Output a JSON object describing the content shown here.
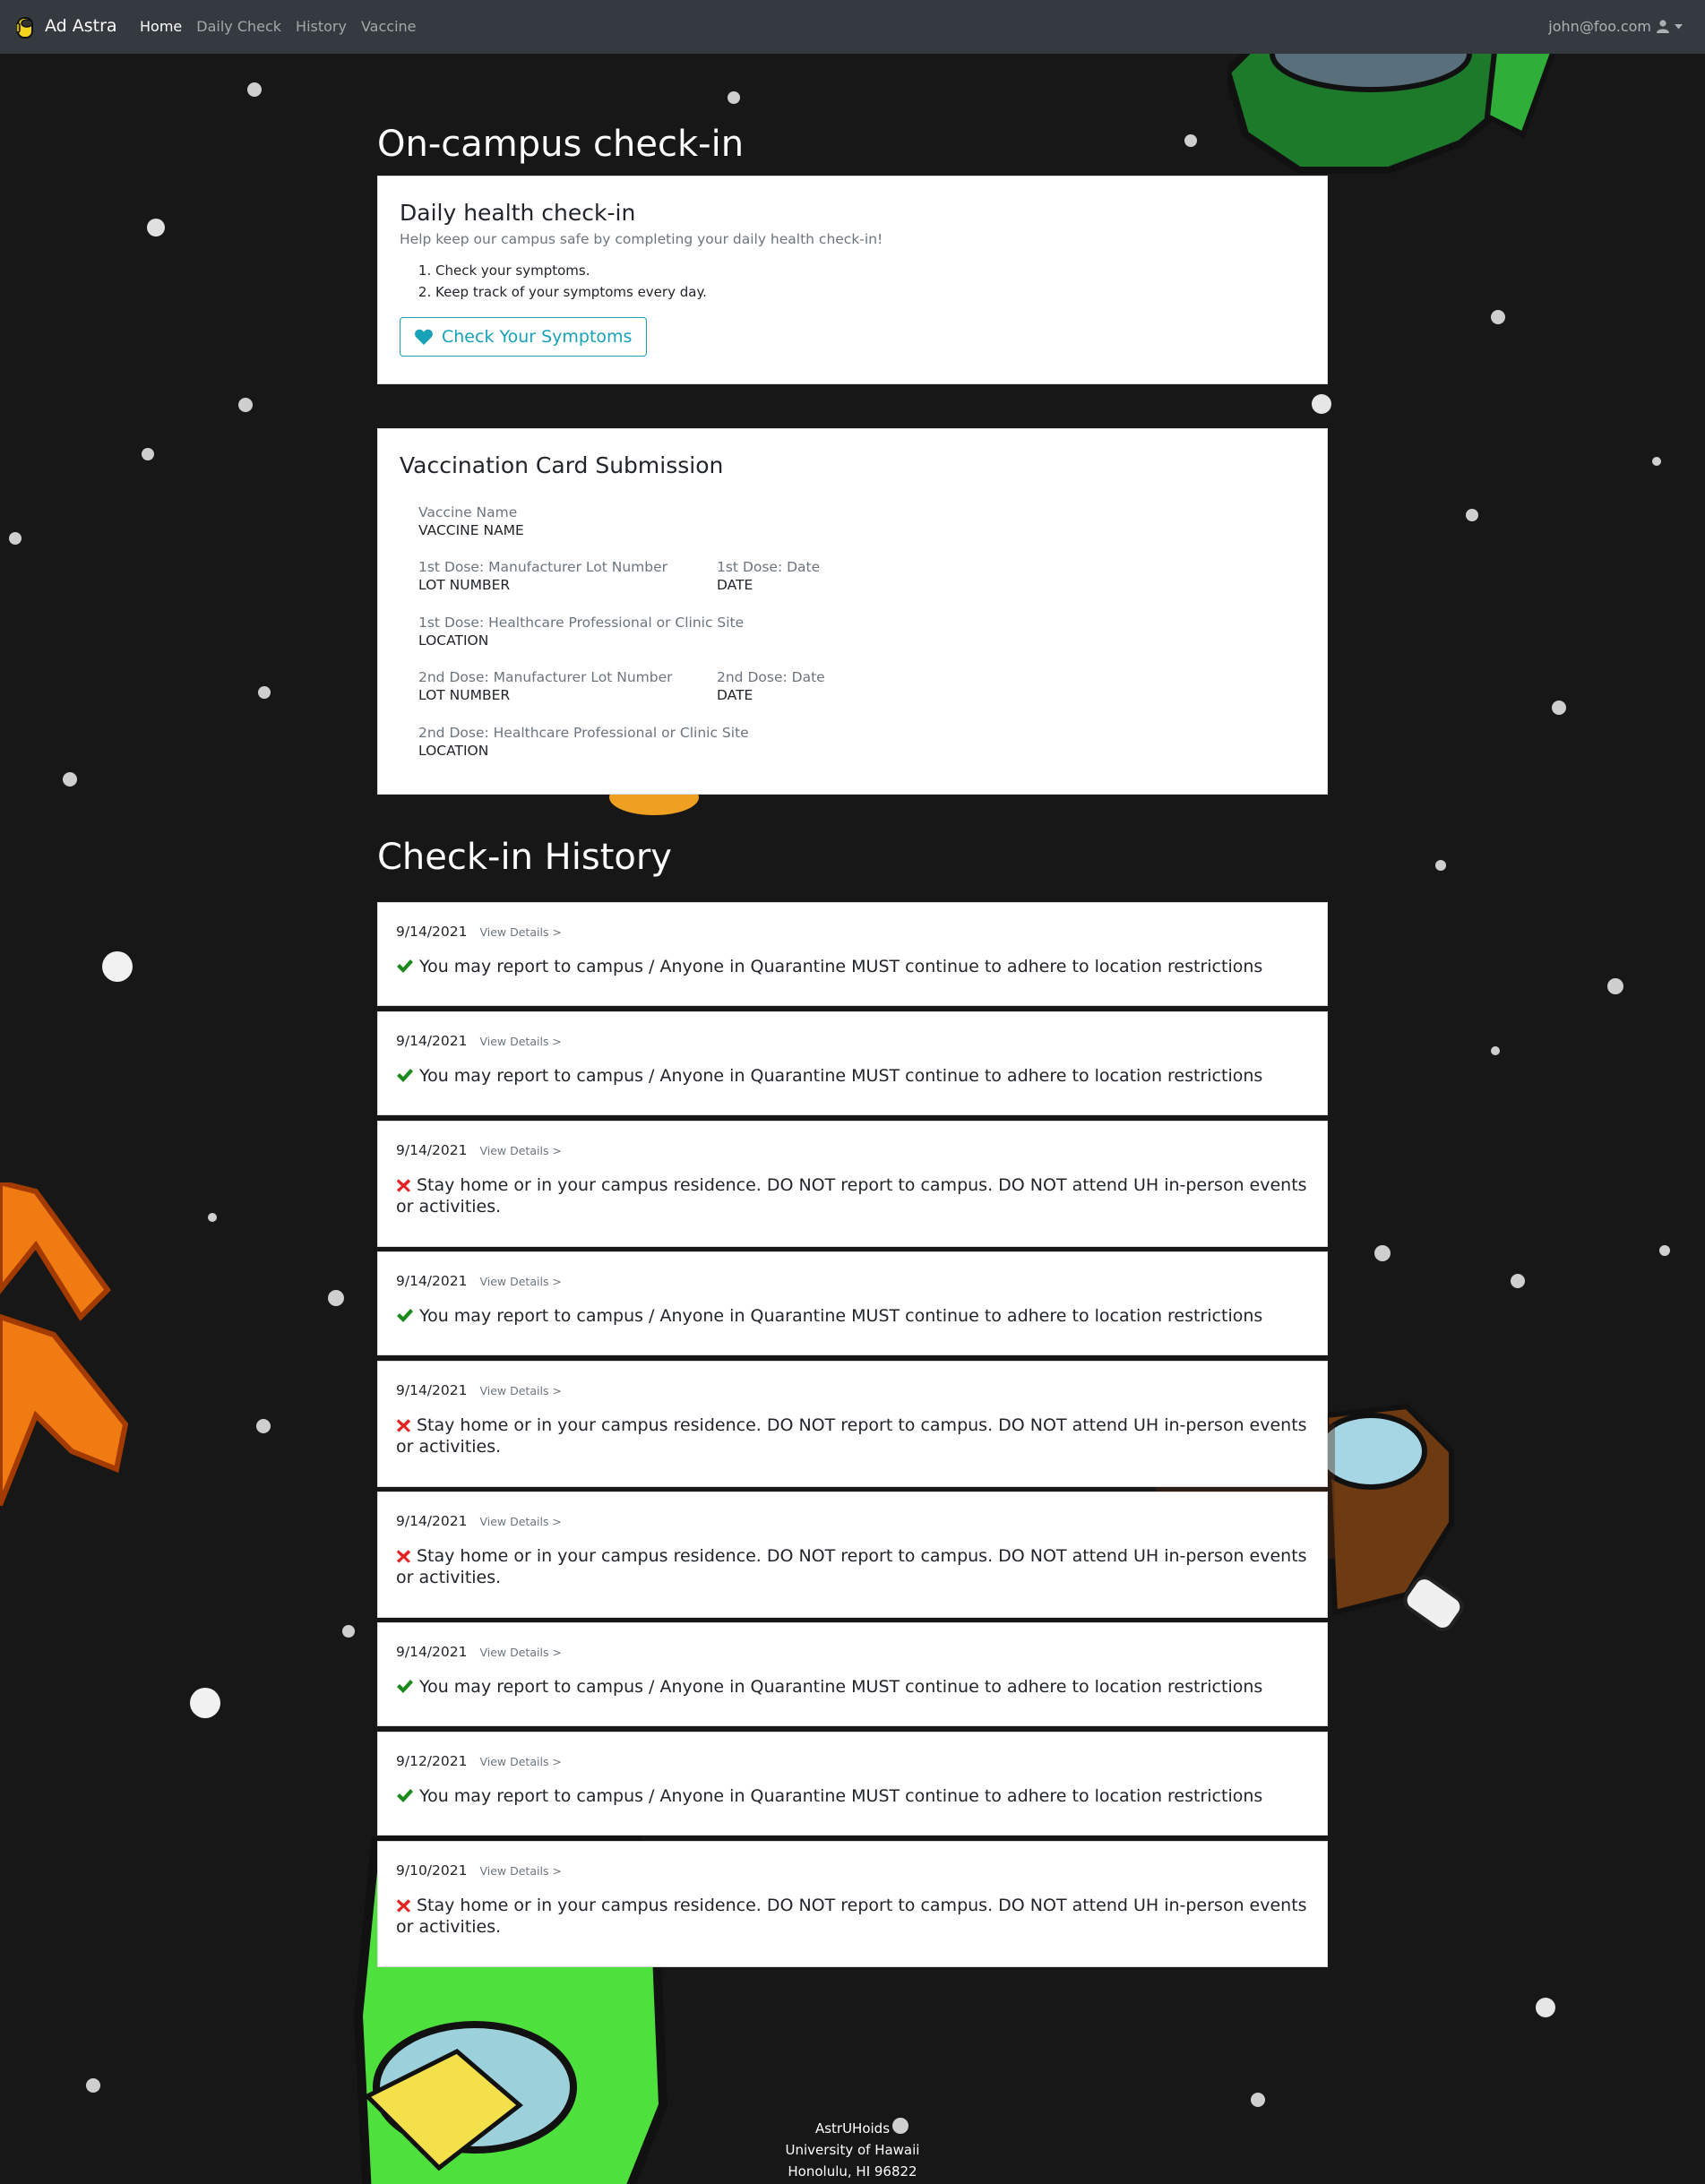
{
  "nav": {
    "brand": "Ad Astra",
    "links": [
      "Home",
      "Daily Check",
      "History",
      "Vaccine"
    ],
    "user": "john@foo.com"
  },
  "checkin": {
    "section_title": "On-campus check-in",
    "card_title": "Daily health check-in",
    "subtitle": "Help keep our campus safe by completing your daily health check-in!",
    "steps": [
      "Check your symptoms.",
      "Keep track of your symptoms every day."
    ],
    "button": "Check Your Symptoms"
  },
  "vaccine": {
    "card_title": "Vaccination Card Submission",
    "fields": {
      "name_label": "Vaccine Name",
      "name_value": "VACCINE NAME",
      "d1_lot_label": "1st Dose: Manufacturer Lot Number",
      "d1_lot_value": "LOT NUMBER",
      "d1_date_label": "1st Dose: Date",
      "d1_date_value": "DATE",
      "d1_site_label": "1st Dose: Healthcare Professional or Clinic Site",
      "d1_site_value": "LOCATION",
      "d2_lot_label": "2nd Dose: Manufacturer Lot Number",
      "d2_lot_value": "LOT NUMBER",
      "d2_date_label": "2nd Dose: Date",
      "d2_date_value": "DATE",
      "d2_site_label": "2nd Dose: Healthcare Professional or Clinic Site",
      "d2_site_value": "LOCATION"
    }
  },
  "history": {
    "section_title": "Check-in History",
    "view_details": "View Details >",
    "entries": [
      {
        "date": "9/14/2021",
        "status": "ok",
        "message": "You may report to campus / Anyone in Quarantine MUST continue to adhere to location restrictions"
      },
      {
        "date": "9/14/2021",
        "status": "ok",
        "message": "You may report to campus / Anyone in Quarantine MUST continue to adhere to location restrictions"
      },
      {
        "date": "9/14/2021",
        "status": "stay",
        "message": "Stay home or in your campus residence. DO NOT report to campus. DO NOT attend UH in-person events or activities."
      },
      {
        "date": "9/14/2021",
        "status": "ok",
        "message": "You may report to campus / Anyone in Quarantine MUST continue to adhere to location restrictions"
      },
      {
        "date": "9/14/2021",
        "status": "stay",
        "message": "Stay home or in your campus residence. DO NOT report to campus. DO NOT attend UH in-person events or activities."
      },
      {
        "date": "9/14/2021",
        "status": "stay",
        "message": "Stay home or in your campus residence. DO NOT report to campus. DO NOT attend UH in-person events or activities."
      },
      {
        "date": "9/14/2021",
        "status": "ok",
        "message": "You may report to campus / Anyone in Quarantine MUST continue to adhere to location restrictions"
      },
      {
        "date": "9/12/2021",
        "status": "ok",
        "message": "You may report to campus / Anyone in Quarantine MUST continue to adhere to location restrictions"
      },
      {
        "date": "9/10/2021",
        "status": "stay",
        "message": "Stay home or in your campus residence. DO NOT report to campus. DO NOT attend UH in-person events or activities."
      }
    ]
  },
  "footer": [
    "AstrUHoids",
    "University of Hawaii",
    "Honolulu, HI 96822"
  ],
  "colors": {
    "ok": "#1a8a1a",
    "stay": "#e52323",
    "accent": "#17a2b8",
    "navbar": "#343a40"
  }
}
